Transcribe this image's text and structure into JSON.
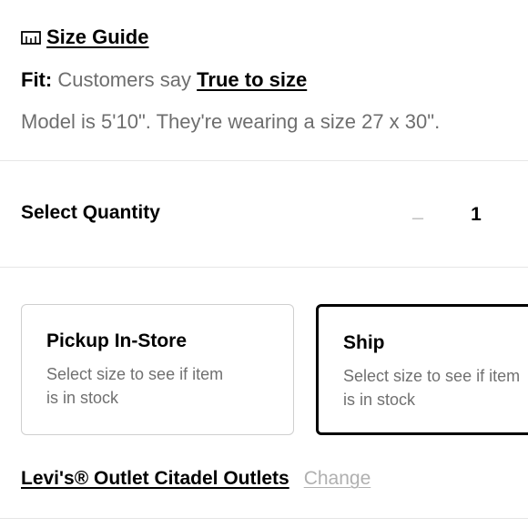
{
  "size_guide": {
    "icon": "ruler-icon",
    "label": "Size Guide"
  },
  "fit": {
    "label": "Fit:",
    "text": "Customers say",
    "value": "True to size"
  },
  "model_info": "Model is 5'10\". They're wearing a size 27 x 30\".",
  "quantity": {
    "label": "Select Quantity",
    "minus_symbol": "–",
    "value": "1"
  },
  "fulfillment": {
    "pickup": {
      "title": "Pickup In-Store",
      "desc_line1": "Select size to see if item",
      "desc_line2": "is in stock"
    },
    "ship": {
      "title": "Ship",
      "desc_line1": "Select size to see if item",
      "desc_line2": "is in stock",
      "selected": true
    }
  },
  "store": {
    "name": "Levi's® Outlet Citadel Outlets",
    "change_label": "Change"
  },
  "colors": {
    "text": "#000000",
    "muted": "#6e6e6e",
    "border": "#cfcfcf",
    "disabled": "#b0b0b0"
  }
}
